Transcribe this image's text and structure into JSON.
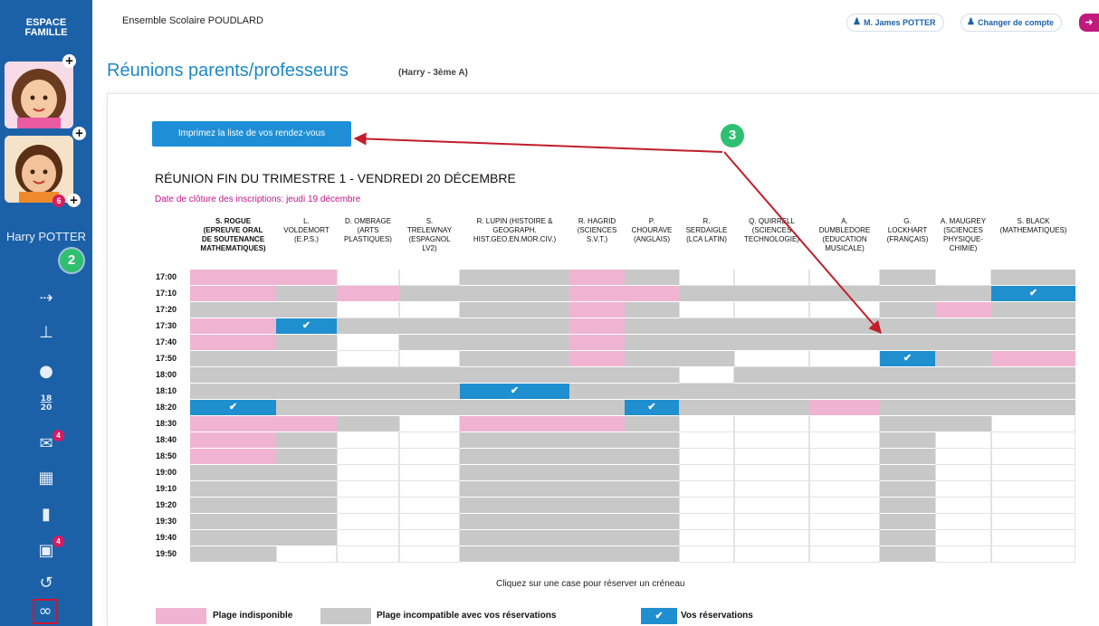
{
  "sidebar": {
    "brand_line1": "ESPACE",
    "brand_line2": "FAMILLE",
    "student_name": "Harry POTTER",
    "kid2_badge": "6",
    "step2": "2",
    "messages_badge": "4",
    "docs_badge": "4",
    "grades_top": "18",
    "grades_bottom": "20"
  },
  "header": {
    "school": "Ensemble Scolaire POUDLARD",
    "user_button": "M. James POTTER",
    "switch_account": "Changer de compte"
  },
  "page": {
    "title": "Réunions parents/professeurs",
    "subtitle": "(Harry - 3ème A)",
    "print_button": "Imprimez la liste de vos rendez-vous",
    "step3": "3",
    "meeting_title": "RÉUNION FIN DU TRIMESTRE 1 - VENDREDI 20 DÉCEMBRE",
    "deadline": "Date de clôture des inscriptions: jeudi 19 décembre",
    "hint": "Cliquez sur une case pour réserver un créneau"
  },
  "colors": {
    "unavailable": "#f0b4d2",
    "incompatible": "#c8c8c8",
    "reserved": "#1f8fd0",
    "accent": "#1e88c8"
  },
  "legend": {
    "unavailable": "Plage indisponible",
    "incompatible": "Plage incompatible avec vos réservations",
    "reserved": "Vos réservations"
  },
  "times": [
    "17:00",
    "17:10",
    "17:20",
    "17:30",
    "17:40",
    "17:50",
    "18:00",
    "18:10",
    "18:20",
    "18:30",
    "18:40",
    "18:50",
    "19:00",
    "19:10",
    "19:20",
    "19:30",
    "19:40",
    "19:50"
  ],
  "teachers": [
    {
      "label": "S. ROGUE (EPREUVE ORAL DE SOUTENANCE MATHEMATIQUES)",
      "lines": [
        "S. ROGUE",
        "(EPREUVE ORAL",
        "DE SOUTENANCE",
        "MATHEMATIQUES)"
      ],
      "bold": true,
      "slots": "ppgppgcgbpppggggggg"
    },
    {
      "label": "L. VOLDEMORT (E.P.S.)",
      "lines": [
        "L.",
        "VOLDEMORT",
        "(E.P.S.)"
      ],
      "bold": false,
      "slots": "pggbgggggpggggggg"
    },
    {
      "label": "D. OMBRAGE (ARTS PLASTIQUES)",
      "lines": [
        "D. OMBRAGE",
        "(ARTS",
        "PLASTIQUES)"
      ],
      "bold": false,
      "slots": "wpwgwwggggwwwwwww"
    },
    {
      "label": "S. TRELEWNAY (ESPAGNOL LV2)",
      "lines": [
        "S.",
        "TRELEWNAY",
        "(ESPAGNOL",
        "LV2)"
      ],
      "bold": false,
      "slots": "wgwggwgggwwwwwwww"
    },
    {
      "label": "R. LUPIN (HISTOIRE & GEOGRAPH. HIST.GEO.EN.MOR.CIV.)",
      "lines": [
        "R. LUPIN (HISTOIRE &",
        "GEOGRAPH.",
        "HIST.GEO.EN.MOR.CIV.)"
      ],
      "bold": false,
      "slots": "gggggggbgpggggggggg"
    },
    {
      "label": "R. HAGRID (SCIENCES S.V.T.)",
      "lines": [
        "R. HAGRID",
        "(SCIENCES",
        "S.V.T.)"
      ],
      "bold": false,
      "slots": "ppppppgggpggggggggg"
    },
    {
      "label": "P. CHOURAVE (ANGLAIS)",
      "lines": [
        "P.",
        "CHOURAVE",
        "(ANGLAIS)"
      ],
      "bold": false,
      "slots": "gpggggggbgggggggggg"
    },
    {
      "label": "R. SERDAIGLE (LCA LATIN)",
      "lines": [
        "R.",
        "SERDAIGLE",
        "(LCA LATIN)"
      ],
      "bold": false,
      "slots": "wgwgggwggwwwwwwwwww"
    },
    {
      "label": "Q. QUIRRELL (SCIENCES TECHNOLOGIE)",
      "lines": [
        "Q. QUIRRELL",
        "(SCIENCES",
        "TECHNOLOGIE)"
      ],
      "bold": false,
      "slots": "wgwggwgggwwwwwwwwww"
    },
    {
      "label": "A. DUMBLEDORE (EDUCATION MUSICALE)",
      "lines": [
        "A.",
        "DUMBLEDORE",
        "(EDUCATION",
        "MUSICALE)"
      ],
      "bold": false,
      "slots": "wgwggwggpwwwwwwwwww"
    },
    {
      "label": "G. LOCKHART (FRANÇAIS)",
      "lines": [
        "G.",
        "LOCKHART",
        "(FRANÇAIS)"
      ],
      "bold": false,
      "slots": "gggggbgggggggggggggg"
    },
    {
      "label": "A. MAUGREY (SCIENCES PHYSIQUE-CHIMIE)",
      "lines": [
        "A. MAUGREY",
        "(SCIENCES",
        "PHYSIQUE-",
        "CHIMIE)"
      ],
      "bold": false,
      "slots": "wgpgggggggwwwwwwwww"
    },
    {
      "label": "S. BLACK (MATHEMATIQUES)",
      "lines": [
        "S. BLACK",
        "(MATHEMATIQUES)"
      ],
      "bold": false,
      "slots": "gbgggpgggwwwwwwwwww"
    }
  ]
}
